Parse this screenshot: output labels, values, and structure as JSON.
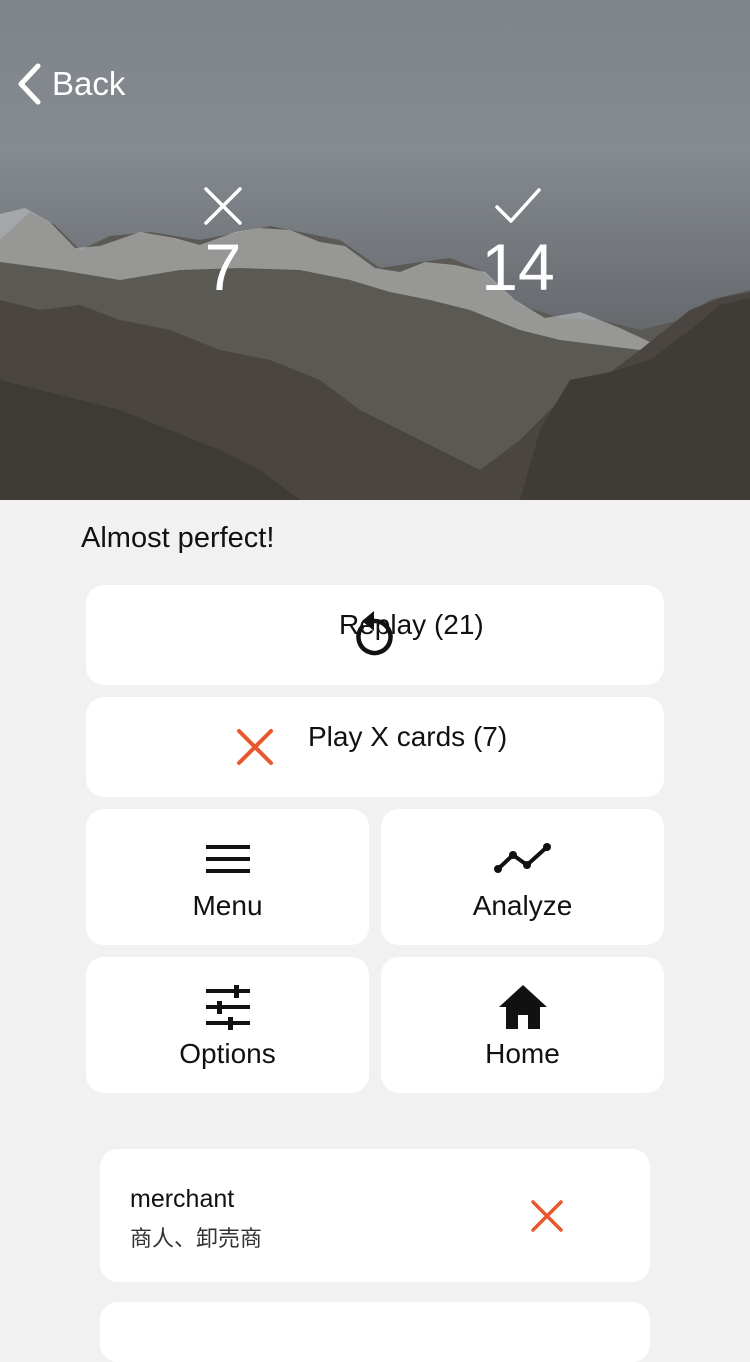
{
  "header": {
    "back_label": "Back",
    "wrong_count": "7",
    "correct_count": "14"
  },
  "result": {
    "headline": "Almost perfect!"
  },
  "actions": {
    "replay_label": "Replay (21)",
    "play_x_label": "Play X cards (7)",
    "menu_label": "Menu",
    "analyze_label": "Analyze",
    "options_label": "Options",
    "home_label": "Home"
  },
  "cards": [
    {
      "term": "merchant",
      "definition": "商人、卸売商",
      "status": "wrong"
    }
  ],
  "colors": {
    "accent_wrong": "#e8572e",
    "background": "#f1f1f1",
    "card": "#ffffff"
  },
  "icons": {
    "back": "chevron-left-icon",
    "wrong": "close-icon",
    "correct": "check-icon",
    "replay": "replay-icon",
    "menu": "menu-icon",
    "analyze": "line-chart-icon",
    "options": "sliders-icon",
    "home": "home-icon"
  }
}
